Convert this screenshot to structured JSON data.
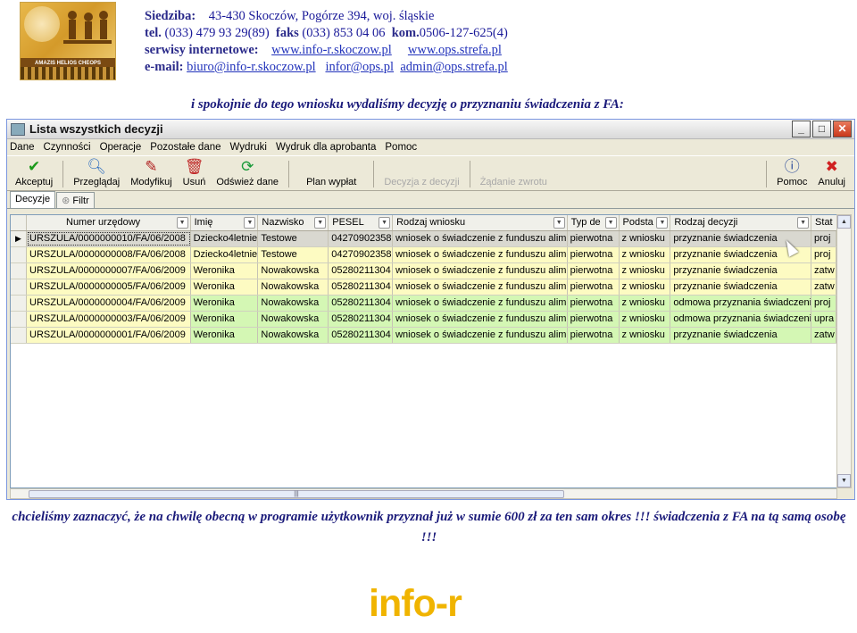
{
  "logo": {
    "band_text": "AMAZIS HELIOS CHEOPS"
  },
  "header": {
    "line1_label": "Siedziba:",
    "line1_value": "43-430 Skoczów,  Pogórze 394,  woj. śląskie",
    "line2_tel_label": "tel.",
    "line2_tel": "(033) 479 93 29(89)",
    "line2_fax_label": "faks",
    "line2_fax": "(033) 853 04 06",
    "line2_kom_label": "kom.",
    "line2_kom": "0506-127-625(4)",
    "line3_label": "serwisy internetowe:",
    "line3_link1": "www.info-r.skoczow.pl",
    "line3_link2": "www.ops.strefa.pl",
    "line4_label": "e-mail:",
    "line4_link1": "biuro@info-r.skoczow.pl",
    "line4_link2": "infor@ops.pl",
    "line4_link3": "admin@ops.strefa.pl"
  },
  "intro_text": "i spokojnie do tego wniosku wydaliśmy decyzję o przyznaniu świadczenia z FA:",
  "window": {
    "title": "Lista wszystkich decyzji",
    "min": "_",
    "max": "□",
    "close": "✕"
  },
  "menu": [
    "Dane",
    "Czynności",
    "Operacje",
    "Pozostałe dane",
    "Wydruki",
    "Wydruk dla aprobanta",
    "Pomoc"
  ],
  "toolbar": {
    "akceptuj": "Akceptuj",
    "przegladaj": "Przeglądaj",
    "modyfikuj": "Modyfikuj",
    "usun": "Usuń",
    "odswiez": "Odśwież dane",
    "plan": "Plan wypłat",
    "decyzja": "Decyzja z decyzji",
    "zadanie": "Żądanie zwrotu",
    "pomoc": "Pomoc",
    "anuluj": "Anuluj"
  },
  "tabs": {
    "decyzje": "Decyzje",
    "filtr": "Filtr"
  },
  "grid": {
    "headers": [
      "Numer urzędowy",
      "Imię",
      "Nazwisko",
      "PESEL",
      "Rodzaj wniosku",
      "Typ de",
      "Podsta",
      "Rodzaj decyzji",
      "Stat"
    ],
    "rows": [
      [
        "URSZULA/0000000010/FA/06/2008",
        "Dziecko4letnie",
        "Testowe",
        "04270902358",
        "wniosek o świadczenie z funduszu alime",
        "pierwotna",
        "z wniosku",
        "przyznanie świadczenia",
        "proj"
      ],
      [
        "URSZULA/0000000008/FA/06/2008",
        "Dziecko4letnie",
        "Testowe",
        "04270902358",
        "wniosek o świadczenie z funduszu alime",
        "pierwotna",
        "z wniosku",
        "przyznanie świadczenia",
        "proj"
      ],
      [
        "URSZULA/0000000007/FA/06/2009",
        "Weronika",
        "Nowakowska",
        "05280211304",
        "wniosek o świadczenie z funduszu alime",
        "pierwotna",
        "z wniosku",
        "przyznanie świadczenia",
        "zatw"
      ],
      [
        "URSZULA/0000000005/FA/06/2009",
        "Weronika",
        "Nowakowska",
        "05280211304",
        "wniosek o świadczenie z funduszu alime",
        "pierwotna",
        "z wniosku",
        "przyznanie świadczenia",
        "zatw"
      ],
      [
        "URSZULA/0000000004/FA/06/2009",
        "Weronika",
        "Nowakowska",
        "05280211304",
        "wniosek o świadczenie z funduszu alime",
        "pierwotna",
        "z wniosku",
        "odmowa przyznania świadczenia",
        "proj"
      ],
      [
        "URSZULA/0000000003/FA/06/2009",
        "Weronika",
        "Nowakowska",
        "05280211304",
        "wniosek o świadczenie z funduszu alime",
        "pierwotna",
        "z wniosku",
        "odmowa przyznania świadczenia",
        "upra"
      ],
      [
        "URSZULA/0000000001/FA/06/2009",
        "Weronika",
        "Nowakowska",
        "05280211304",
        "wniosek o świadczenie z funduszu alime",
        "pierwotna",
        "z wniosku",
        "przyznanie świadczenia",
        "zatw"
      ]
    ]
  },
  "note_text": "chcieliśmy zaznaczyć, że na chwilę obecną w programie użytkownik przyznał już w sumie 600 zł za ten sam okres !!! świadczenia z FA na tą samą osobę !!!",
  "footer_logo": "info-r"
}
